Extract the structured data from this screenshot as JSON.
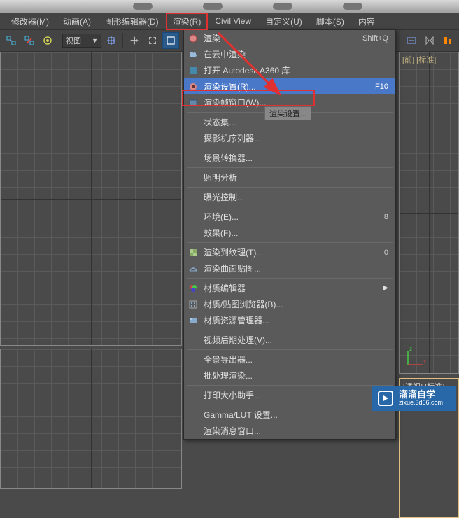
{
  "menubar": {
    "items": [
      {
        "label": "修改器(M)"
      },
      {
        "label": "动画(A)"
      },
      {
        "label": "图形编辑器(D)"
      },
      {
        "label": "渲染(R)"
      },
      {
        "label": "Civil View"
      },
      {
        "label": "自定义(U)"
      },
      {
        "label": "脚本(S)"
      },
      {
        "label": "内容"
      }
    ]
  },
  "toolbar": {
    "view_label": "视图"
  },
  "viewports": {
    "right_label1": "[前]",
    "right_label2": "[标准]",
    "br_label1": "[透视]",
    "br_label2": "[标准]"
  },
  "dropdown": {
    "items": [
      {
        "label": "渲染",
        "shortcut": "Shift+Q",
        "icon": "render-icon"
      },
      {
        "label": "在云中渲染",
        "icon": "cloud-icon"
      },
      {
        "label": "打开 Autodesk A360 库",
        "icon": "a360-icon"
      },
      {
        "label": "渲染设置(R)...",
        "shortcut": "F10",
        "icon": "settings-icon",
        "highlighted": true
      },
      {
        "label": "渲染帧窗口(W)...",
        "icon": "frame-icon",
        "sublabel": "渲染设置..."
      },
      {
        "sep": true
      },
      {
        "label": "状态集..."
      },
      {
        "label": "摄影机序列器..."
      },
      {
        "sep": true
      },
      {
        "label": "场景转换器..."
      },
      {
        "sep": true
      },
      {
        "label": "照明分析"
      },
      {
        "sep": true
      },
      {
        "label": "曝光控制..."
      },
      {
        "sep": true
      },
      {
        "label": "环境(E)...",
        "shortcut": "8"
      },
      {
        "label": "效果(F)..."
      },
      {
        "sep": true
      },
      {
        "label": "渲染到纹理(T)...",
        "shortcut": "0",
        "icon": "texture-icon"
      },
      {
        "label": "渲染曲面贴图...",
        "icon": "surface-icon"
      },
      {
        "sep": true
      },
      {
        "label": "材质编辑器",
        "icon": "material-icon",
        "submenu": true
      },
      {
        "label": "材质/贴图浏览器(B)...",
        "icon": "browser-icon"
      },
      {
        "label": "材质资源管理器...",
        "icon": "explorer-icon"
      },
      {
        "sep": true
      },
      {
        "label": "视频后期处理(V)..."
      },
      {
        "sep": true
      },
      {
        "label": "全景导出器..."
      },
      {
        "label": "批处理渲染..."
      },
      {
        "sep": true
      },
      {
        "label": "打印大小助手..."
      },
      {
        "sep": true
      },
      {
        "label": "Gamma/LUT 设置..."
      },
      {
        "label": "渲染消息窗口..."
      }
    ]
  },
  "watermark": {
    "title": "溜溜自学",
    "sub": "zixue.3d66.com"
  }
}
